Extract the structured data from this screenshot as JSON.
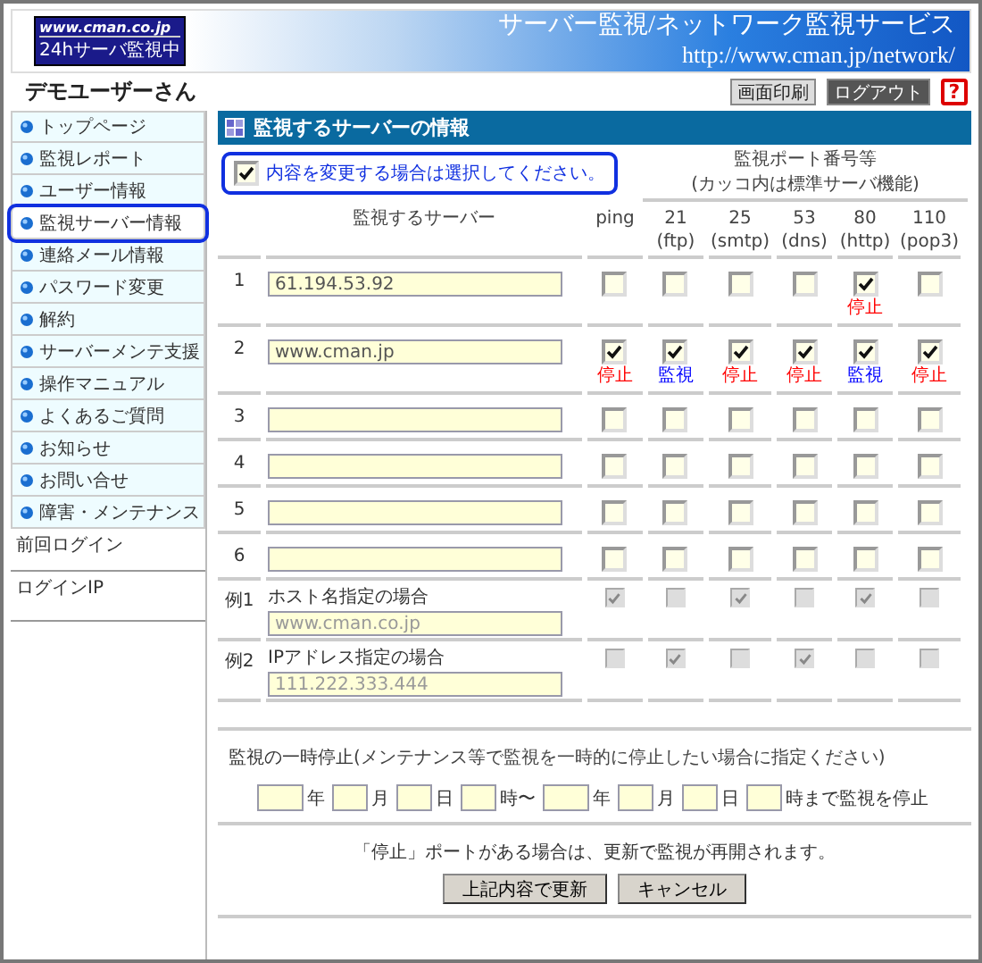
{
  "header": {
    "logo_lines": [
      "www.cman.co.jp",
      "24hサーバ監視中"
    ],
    "service_name": "サーバー監視/ネットワーク監視サービス",
    "url": "http://www.cman.jp/network/"
  },
  "user_name": "デモユーザーさん",
  "toolbar": {
    "buttons": [
      {
        "label": "画面印刷",
        "kind": "light"
      },
      {
        "label": "ログアウト",
        "kind": "dark"
      }
    ],
    "help": "?"
  },
  "sidebar": {
    "items": [
      {
        "label": "トップページ",
        "selected": false
      },
      {
        "label": "監視レポート",
        "selected": false
      },
      {
        "label": "ユーザー情報",
        "selected": false
      },
      {
        "label": "監視サーバー情報",
        "selected": true
      },
      {
        "label": "連絡メール情報",
        "selected": false
      },
      {
        "label": "パスワード変更",
        "selected": false
      },
      {
        "label": "解約",
        "selected": false
      },
      {
        "label": "サーバーメンテ支援",
        "selected": false
      },
      {
        "label": "操作マニュアル",
        "selected": false
      },
      {
        "label": "よくあるご質問",
        "selected": false
      },
      {
        "label": "お知らせ",
        "selected": false
      },
      {
        "label": "お問い合せ",
        "selected": false
      },
      {
        "label": "障害・メンテナンス",
        "selected": false
      }
    ],
    "info": [
      {
        "label": "前回ログイン"
      },
      {
        "label": "ログインIP"
      }
    ]
  },
  "panel": {
    "title": "監視するサーバーの情報",
    "edit_checkbox": {
      "label": "内容を変更する場合は選択してください。",
      "checked": true
    },
    "ports_heading": "監視ポート番号等",
    "ports_note": "(カッコ内は標準サーバ機能)",
    "server_column": "監視するサーバー",
    "ports": [
      {
        "number": "ping"
      },
      {
        "number": "21",
        "service": "(ftp)"
      },
      {
        "number": "25",
        "service": "(smtp)"
      },
      {
        "number": "53",
        "service": "(dns)"
      },
      {
        "number": "80",
        "service": "(http)"
      },
      {
        "number": "110",
        "service": "(pop3)"
      }
    ],
    "servers": [
      {
        "index": "1",
        "host": "61.194.53.92",
        "ports": [
          {
            "checked": false
          },
          {
            "checked": false
          },
          {
            "checked": false
          },
          {
            "checked": false
          },
          {
            "checked": true,
            "status": "停止",
            "color": "#ff0000"
          },
          {
            "checked": false
          }
        ]
      },
      {
        "index": "2",
        "host": "www.cman.jp",
        "ports": [
          {
            "checked": true,
            "status": "停止",
            "color": "#ff0000"
          },
          {
            "checked": true,
            "status": "監視",
            "color": "#0000ff"
          },
          {
            "checked": true,
            "status": "停止",
            "color": "#ff0000"
          },
          {
            "checked": true,
            "status": "停止",
            "color": "#ff0000"
          },
          {
            "checked": true,
            "status": "監視",
            "color": "#0000ff"
          },
          {
            "checked": true,
            "status": "停止",
            "color": "#ff0000"
          }
        ]
      },
      {
        "index": "3",
        "ports": [
          {
            "checked": false
          },
          {
            "checked": false
          },
          {
            "checked": false
          },
          {
            "checked": false
          },
          {
            "checked": false
          },
          {
            "checked": false
          }
        ]
      },
      {
        "index": "4",
        "ports": [
          {
            "checked": false
          },
          {
            "checked": false
          },
          {
            "checked": false
          },
          {
            "checked": false
          },
          {
            "checked": false
          },
          {
            "checked": false
          }
        ]
      },
      {
        "index": "5",
        "ports": [
          {
            "checked": false
          },
          {
            "checked": false
          },
          {
            "checked": false
          },
          {
            "checked": false
          },
          {
            "checked": false
          },
          {
            "checked": false
          }
        ]
      },
      {
        "index": "6",
        "ports": [
          {
            "checked": false
          },
          {
            "checked": false
          },
          {
            "checked": false
          },
          {
            "checked": false
          },
          {
            "checked": false
          },
          {
            "checked": false
          }
        ]
      }
    ],
    "examples": [
      {
        "index": "例1",
        "label": "ホスト名指定の場合",
        "host": "www.cman.co.jp",
        "ports": [
          {
            "checked": true
          },
          {
            "checked": false
          },
          {
            "checked": true
          },
          {
            "checked": false
          },
          {
            "checked": true
          },
          {
            "checked": false
          }
        ]
      },
      {
        "index": "例2",
        "label": "IPアドレス指定の場合",
        "host": "111.222.333.444",
        "ports": [
          {
            "checked": false
          },
          {
            "checked": true
          },
          {
            "checked": false
          },
          {
            "checked": true
          },
          {
            "checked": false
          },
          {
            "checked": false
          }
        ]
      }
    ]
  },
  "pause": {
    "title": "監視の一時停止",
    "note": "(メンテナンス等で監視を一時的に停止したい場合に指定ください)",
    "fields": [
      {
        "unit": "年",
        "kind": "year"
      },
      {
        "unit": "月",
        "kind": "short"
      },
      {
        "unit": "日",
        "kind": "short"
      },
      {
        "unit": "時〜",
        "kind": "short"
      },
      {
        "unit": "年",
        "kind": "year"
      },
      {
        "unit": "月",
        "kind": "short"
      },
      {
        "unit": "日",
        "kind": "short"
      },
      {
        "unit": "時まで監視を停止",
        "kind": "short"
      }
    ]
  },
  "footer": {
    "notice": "「停止」ポートがある場合は、更新で監視が再開されます。",
    "buttons": [
      "上記内容で更新",
      "キャンセル"
    ]
  }
}
